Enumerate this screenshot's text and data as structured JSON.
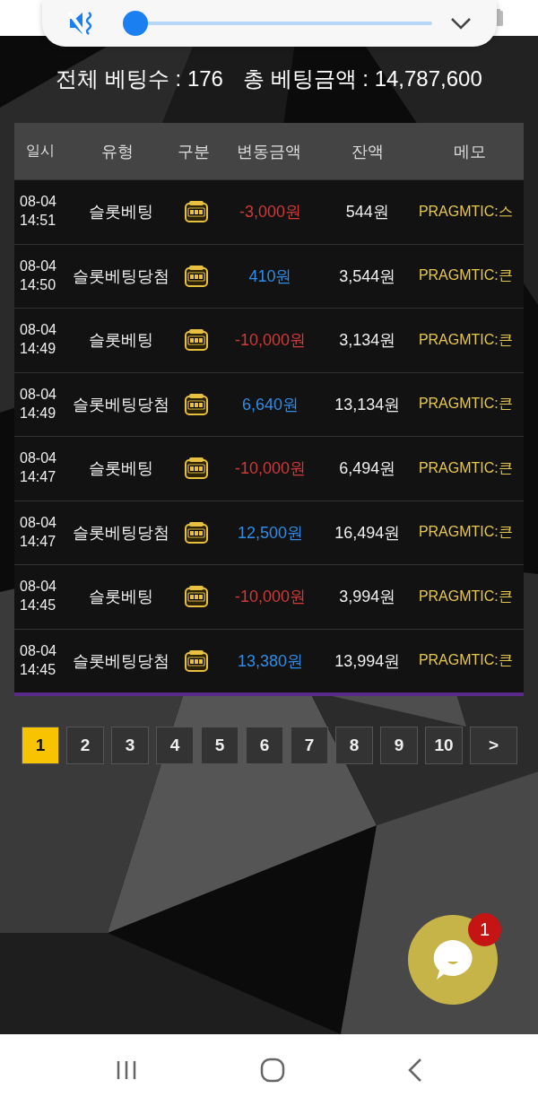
{
  "volume_panel": {
    "muted": true,
    "level": 0.0
  },
  "summary": {
    "total_bets": "전체 베팅수 : 176",
    "total_amount": "총 베팅금액 : 14,787,600"
  },
  "table": {
    "columns": [
      "일시",
      "유형",
      "구분",
      "변동금액",
      "잔액",
      "메모"
    ],
    "rows": [
      {
        "date": "08-04",
        "time": "14:51",
        "type": "슬롯베팅",
        "kind": "slot",
        "negative": true,
        "change": "-3,000원",
        "balance": "544원",
        "memo": "PRAGMTIC:스"
      },
      {
        "date": "08-04",
        "time": "14:50",
        "type": "슬롯베팅당첨",
        "kind": "slot",
        "negative": false,
        "change": "410원",
        "balance": "3,544원",
        "memo": "PRAGMTIC:큰"
      },
      {
        "date": "08-04",
        "time": "14:49",
        "type": "슬롯베팅",
        "kind": "slot",
        "negative": true,
        "change": "-10,000원",
        "balance": "3,134원",
        "memo": "PRAGMTIC:큰"
      },
      {
        "date": "08-04",
        "time": "14:49",
        "type": "슬롯베팅당첨",
        "kind": "slot",
        "negative": false,
        "change": "6,640원",
        "balance": "13,134원",
        "memo": "PRAGMTIC:큰"
      },
      {
        "date": "08-04",
        "time": "14:47",
        "type": "슬롯베팅",
        "kind": "slot",
        "negative": true,
        "change": "-10,000원",
        "balance": "6,494원",
        "memo": "PRAGMTIC:큰"
      },
      {
        "date": "08-04",
        "time": "14:47",
        "type": "슬롯베팅당첨",
        "kind": "slot",
        "negative": false,
        "change": "12,500원",
        "balance": "16,494원",
        "memo": "PRAGMTIC:큰"
      },
      {
        "date": "08-04",
        "time": "14:45",
        "type": "슬롯베팅",
        "kind": "slot",
        "negative": true,
        "change": "-10,000원",
        "balance": "3,994원",
        "memo": "PRAGMTIC:큰"
      },
      {
        "date": "08-04",
        "time": "14:45",
        "type": "슬롯베팅당첨",
        "kind": "slot",
        "negative": false,
        "change": "13,380원",
        "balance": "13,994원",
        "memo": "PRAGMTIC:큰"
      }
    ]
  },
  "pagination": [
    {
      "label": "1",
      "selected": true
    },
    {
      "label": "2",
      "selected": false
    },
    {
      "label": "3",
      "selected": false
    },
    {
      "label": "4",
      "selected": false
    },
    {
      "label": "5",
      "selected": false
    },
    {
      "label": "6",
      "selected": false
    },
    {
      "label": "7",
      "selected": false
    },
    {
      "label": "8",
      "selected": false
    },
    {
      "label": "9",
      "selected": false
    },
    {
      "label": "10",
      "selected": false
    },
    {
      "label": ">",
      "selected": false
    }
  ],
  "chat": {
    "badge": "1"
  }
}
